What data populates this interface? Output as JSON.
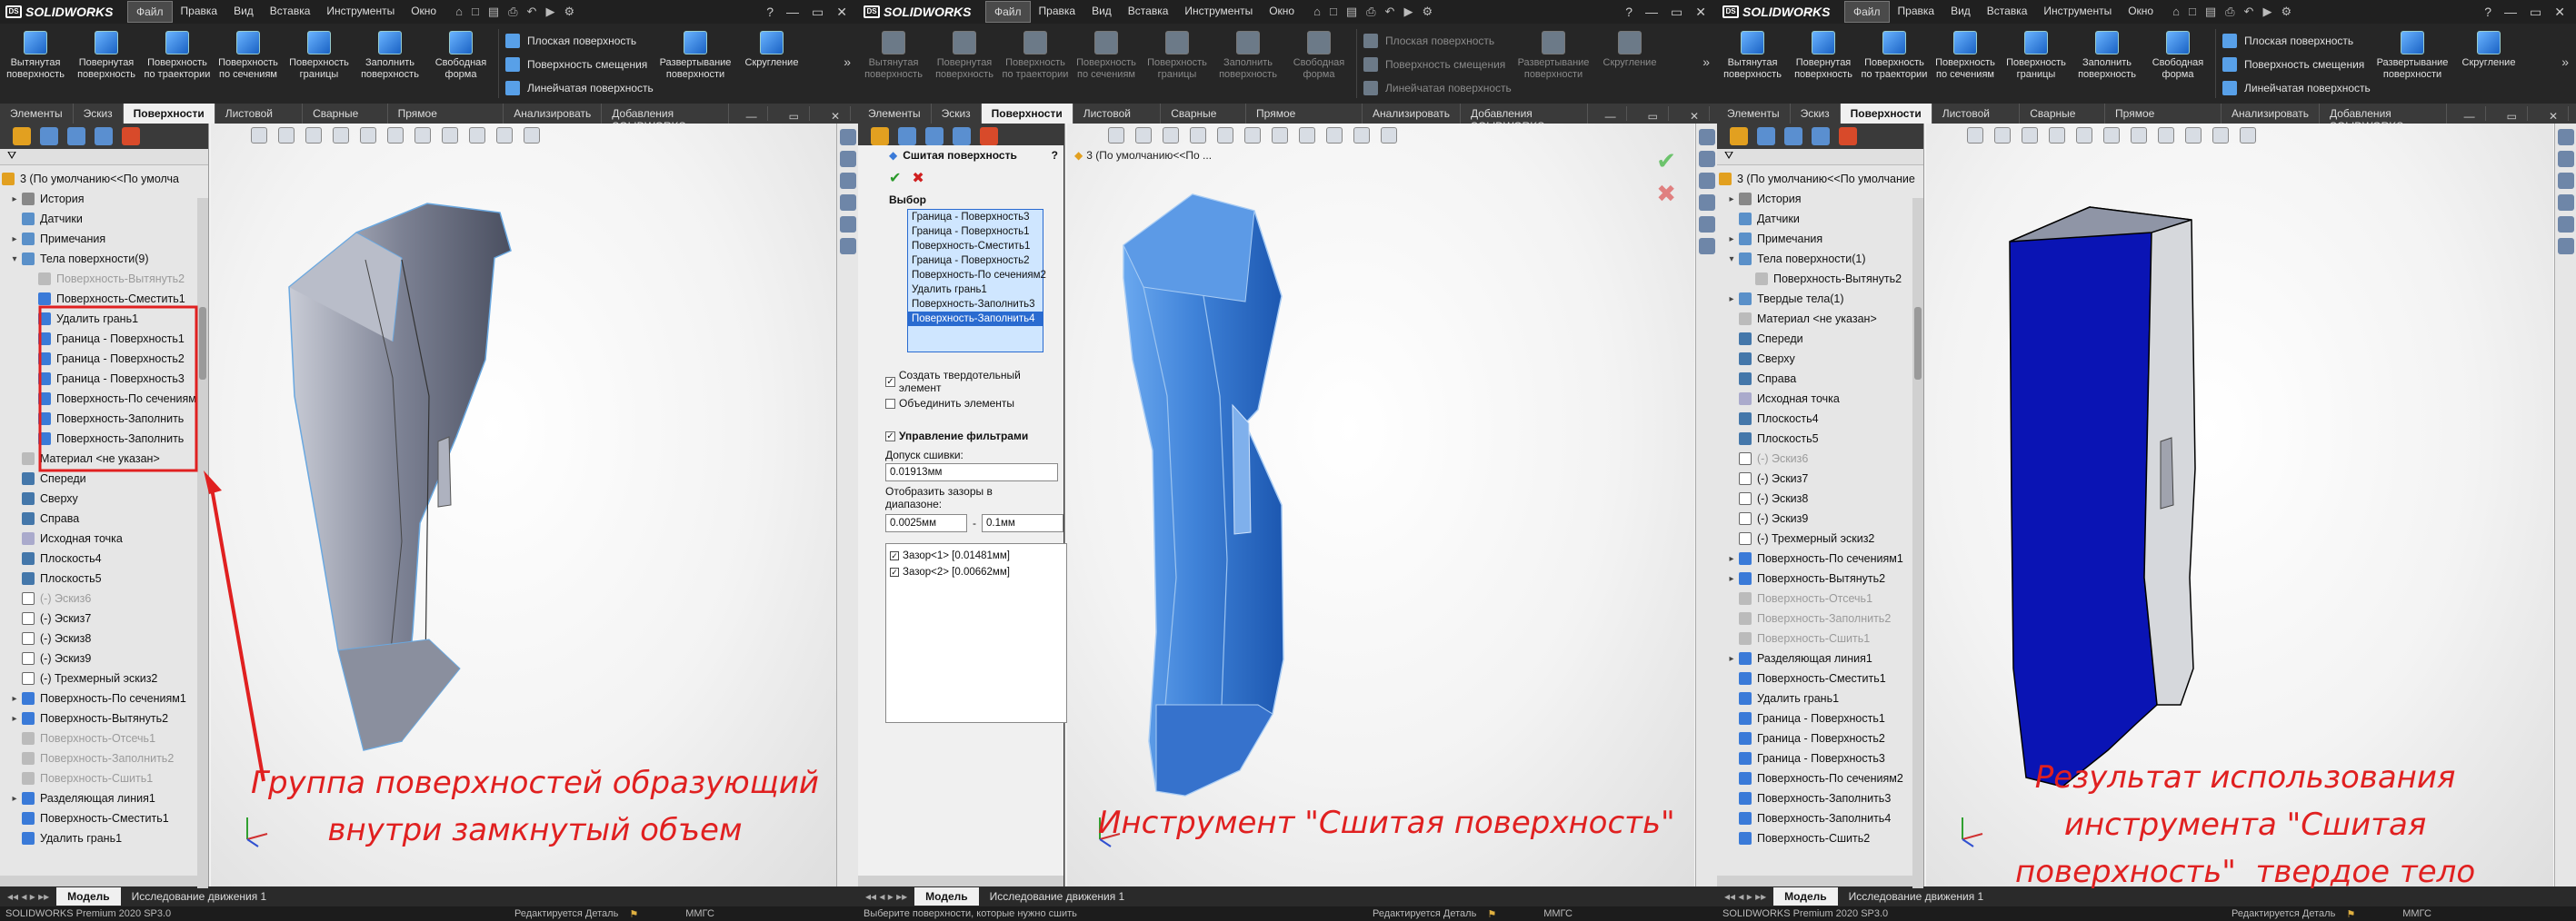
{
  "app": {
    "logo": "SOLIDWORKS",
    "menu": [
      "Файл",
      "Правка",
      "Вид",
      "Вставка",
      "Инструменты",
      "Окно"
    ],
    "menu_active": "Файл"
  },
  "ribbon": {
    "buttons": [
      "Вытянутая поверхность",
      "Повернутая поверхность",
      "Поверхность по траектории",
      "Поверхность по сечениям",
      "Поверхность границы",
      "Заполнить поверхность",
      "Свободная форма"
    ],
    "list": [
      "Плоская поверхность",
      "Поверхность смещения",
      "Линейчатая поверхность"
    ],
    "unfold": "Развертывание поверхности",
    "fillet": "Скругление"
  },
  "tabs": [
    "Элементы",
    "Эскиз",
    "Поверхности",
    "Листовой металл",
    "Сварные детали",
    "Прямое редактирование",
    "Анализировать",
    "Добавления SOLIDWORKS"
  ],
  "tabs_active": "Поверхности",
  "tree1": {
    "root": "3  (По умолчанию<<По умолча",
    "items": [
      {
        "t": "История",
        "ex": "▸",
        "ic": "hist"
      },
      {
        "t": "Датчики",
        "ex": "",
        "ic": "fold"
      },
      {
        "t": "Примечания",
        "ex": "▸",
        "ic": "fold"
      },
      {
        "t": "Тела поверхности(9)",
        "ex": "▾",
        "ic": "fold"
      },
      {
        "t": "Поверхность-Вытянуть2",
        "ex": "",
        "ic": "gray",
        "ind": 2,
        "g": 1
      },
      {
        "t": "Поверхность-Сместить1",
        "ex": "",
        "ic": "surf",
        "ind": 2
      },
      {
        "t": "Удалить грань1",
        "ex": "",
        "ic": "surf",
        "ind": 2
      },
      {
        "t": "Граница - Поверхность1",
        "ex": "",
        "ic": "surf",
        "ind": 2
      },
      {
        "t": "Граница - Поверхность2",
        "ex": "",
        "ic": "surf",
        "ind": 2
      },
      {
        "t": "Граница - Поверхность3",
        "ex": "",
        "ic": "surf",
        "ind": 2
      },
      {
        "t": "Поверхность-По сечениям",
        "ex": "",
        "ic": "surf",
        "ind": 2
      },
      {
        "t": "Поверхность-Заполнить",
        "ex": "",
        "ic": "surf",
        "ind": 2
      },
      {
        "t": "Поверхность-Заполнить",
        "ex": "",
        "ic": "surf",
        "ind": 2
      },
      {
        "t": "Материал <не указан>",
        "ex": "",
        "ic": "mat"
      },
      {
        "t": "Спереди",
        "ex": "",
        "ic": "plane"
      },
      {
        "t": "Сверху",
        "ex": "",
        "ic": "plane"
      },
      {
        "t": "Справа",
        "ex": "",
        "ic": "plane"
      },
      {
        "t": "Исходная точка",
        "ex": "",
        "ic": "pt"
      },
      {
        "t": "Плоскость4",
        "ex": "",
        "ic": "plane"
      },
      {
        "t": "Плоскость5",
        "ex": "",
        "ic": "plane"
      },
      {
        "t": "(-) Эскиз6",
        "ex": "",
        "ic": "sk",
        "g": 1
      },
      {
        "t": "(-) Эскиз7",
        "ex": "",
        "ic": "sk"
      },
      {
        "t": "(-) Эскиз8",
        "ex": "",
        "ic": "sk"
      },
      {
        "t": "(-) Эскиз9",
        "ex": "",
        "ic": "sk"
      },
      {
        "t": "(-) Трехмерный эскиз2",
        "ex": "",
        "ic": "sk"
      },
      {
        "t": "Поверхность-По сечениям1",
        "ex": "▸",
        "ic": "surf"
      },
      {
        "t": "Поверхность-Вытянуть2",
        "ex": "▸",
        "ic": "surf"
      },
      {
        "t": "Поверхность-Отсечь1",
        "ex": "",
        "ic": "gray",
        "g": 1
      },
      {
        "t": "Поверхность-Заполнить2",
        "ex": "",
        "ic": "gray",
        "g": 1
      },
      {
        "t": "Поверхность-Сшить1",
        "ex": "",
        "ic": "gray",
        "g": 1
      },
      {
        "t": "Разделяющая линия1",
        "ex": "▸",
        "ic": "surf"
      },
      {
        "t": "Поверхность-Сместить1",
        "ex": "",
        "ic": "surf"
      },
      {
        "t": "Удалить грань1",
        "ex": "",
        "ic": "surf"
      }
    ]
  },
  "tree3": {
    "root": "3  (По умолчанию<<По умолчание",
    "items": [
      {
        "t": "История",
        "ex": "▸",
        "ic": "hist"
      },
      {
        "t": "Датчики",
        "ex": "",
        "ic": "fold"
      },
      {
        "t": "Примечания",
        "ex": "▸",
        "ic": "fold"
      },
      {
        "t": "Тела поверхности(1)",
        "ex": "▾",
        "ic": "fold"
      },
      {
        "t": "Поверхность-Вытянуть2",
        "ex": "",
        "ic": "gray",
        "ind": 2
      },
      {
        "t": "Твердые тела(1)",
        "ex": "▸",
        "ic": "fold"
      },
      {
        "t": "Материал <не указан>",
        "ex": "",
        "ic": "mat"
      },
      {
        "t": "Спереди",
        "ex": "",
        "ic": "plane"
      },
      {
        "t": "Сверху",
        "ex": "",
        "ic": "plane"
      },
      {
        "t": "Справа",
        "ex": "",
        "ic": "plane"
      },
      {
        "t": "Исходная точка",
        "ex": "",
        "ic": "pt"
      },
      {
        "t": "Плоскость4",
        "ex": "",
        "ic": "plane"
      },
      {
        "t": "Плоскость5",
        "ex": "",
        "ic": "plane"
      },
      {
        "t": "(-) Эскиз6",
        "ex": "",
        "ic": "sk",
        "g": 1
      },
      {
        "t": "(-) Эскиз7",
        "ex": "",
        "ic": "sk"
      },
      {
        "t": "(-) Эскиз8",
        "ex": "",
        "ic": "sk"
      },
      {
        "t": "(-) Эскиз9",
        "ex": "",
        "ic": "sk"
      },
      {
        "t": "(-) Трехмерный эскиз2",
        "ex": "",
        "ic": "sk"
      },
      {
        "t": "Поверхность-По сечениям1",
        "ex": "▸",
        "ic": "surf"
      },
      {
        "t": "Поверхность-Вытянуть2",
        "ex": "▸",
        "ic": "surf"
      },
      {
        "t": "Поверхность-Отсечь1",
        "ex": "",
        "ic": "gray",
        "g": 1
      },
      {
        "t": "Поверхность-Заполнить2",
        "ex": "",
        "ic": "gray",
        "g": 1
      },
      {
        "t": "Поверхность-Сшить1",
        "ex": "",
        "ic": "gray",
        "g": 1
      },
      {
        "t": "Разделяющая линия1",
        "ex": "▸",
        "ic": "surf"
      },
      {
        "t": "Поверхность-Сместить1",
        "ex": "",
        "ic": "surf"
      },
      {
        "t": "Удалить грань1",
        "ex": "",
        "ic": "surf"
      },
      {
        "t": "Граница - Поверхность1",
        "ex": "",
        "ic": "surf"
      },
      {
        "t": "Граница - Поверхность2",
        "ex": "",
        "ic": "surf"
      },
      {
        "t": "Граница - Поверхность3",
        "ex": "",
        "ic": "surf"
      },
      {
        "t": "Поверхность-По сечениям2",
        "ex": "",
        "ic": "surf"
      },
      {
        "t": "Поверхность-Заполнить3",
        "ex": "",
        "ic": "surf"
      },
      {
        "t": "Поверхность-Заполнить4",
        "ex": "",
        "ic": "surf"
      },
      {
        "t": "Поверхность-Сшить2",
        "ex": "",
        "ic": "surf"
      }
    ]
  },
  "pm": {
    "title": "Сшитая поверхность",
    "breadcrumb": "3  (По умолчанию<<По ...",
    "sel_label": "Выбор",
    "sel_items": [
      "Граница - Поверхность3",
      "Граница - Поверхность1",
      "Поверхность-Сместить1",
      "Граница - Поверхность2",
      "Поверхность-По сечениям2",
      "Удалить грань1",
      "Поверхность-Заполнить3",
      "Поверхность-Заполнить4"
    ],
    "chk1": "Создать твердотельный элемент",
    "chk2": "Объединить элементы",
    "filter_label": "Управление фильтрами",
    "tol_label": "Допуск сшивки:",
    "tol": "0.01913мм",
    "gap_label": "Отобразить зазоры в диапазоне:",
    "gap_min": "0.0025мм",
    "gap_dash": "-",
    "gap_max": "0.1мм",
    "gaps": [
      "Зазор<1> [0.01481мм]",
      "Зазор<2> [0.00662мм]"
    ],
    "status": "Выберите поверхности, которые нужно сшить"
  },
  "bottom": {
    "model": "Модель",
    "motion": "Исследование движения 1"
  },
  "status": {
    "version": "SOLIDWORKS Premium 2020 SP3.0",
    "editing": "Редактируется Деталь",
    "units": "ММГС"
  },
  "annot": {
    "a1": "Группа поверхностей образующий\nвнутри замкнутый объем",
    "a2": "Инструмент \"Сшитая поверхность\"",
    "a3": "Результат использования\nинструмента \"Сшитая\nповерхность\"  твердое тело"
  },
  "colors": {
    "highlight": "#e02020",
    "accent": "#2a6bd0",
    "solid": "#0a14b4"
  }
}
